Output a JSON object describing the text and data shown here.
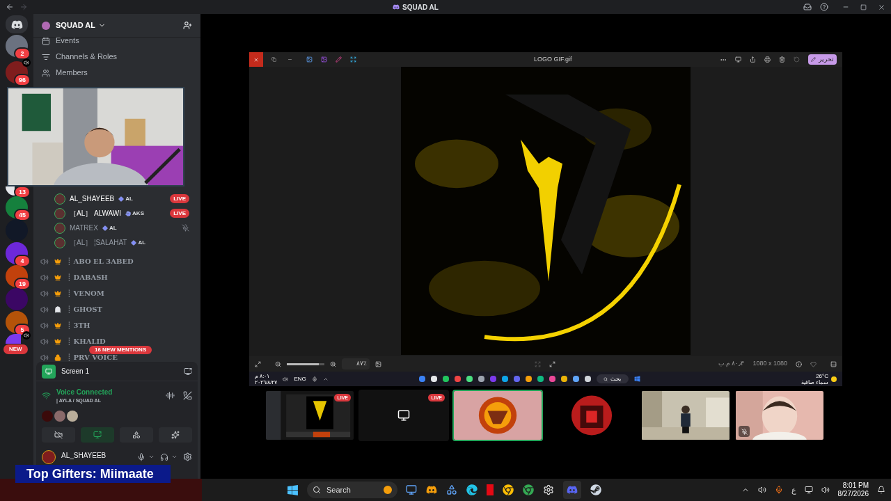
{
  "title_bar": {
    "title": "SQUAD AL"
  },
  "servers": [
    {
      "badge": "2",
      "voice": false,
      "color": "#6b7280"
    },
    {
      "badge": "96",
      "voice": true,
      "color": "#7f1d1d"
    },
    {
      "badge": "13",
      "voice": false,
      "color": "#e5e7eb"
    },
    {
      "badge": "45",
      "voice": false,
      "color": "#15803d"
    },
    {
      "voice": false,
      "color": "#111827"
    },
    {
      "badge": "4",
      "voice": false,
      "color": "#6d28d9"
    },
    {
      "badge": "19",
      "voice": false,
      "color": "#c2410c"
    },
    {
      "voice": false,
      "color": "#3b0764"
    },
    {
      "badge": "5",
      "voice": false,
      "color": "#b45309"
    },
    {
      "voice": true,
      "color": "#7c3aed"
    }
  ],
  "new_pill": "NEW",
  "server": {
    "name": "SQUAD AL",
    "menu": [
      {
        "label": "Events",
        "kind": "calendar"
      },
      {
        "label": "Channels & Roles",
        "kind": "list"
      },
      {
        "label": "Members",
        "kind": "users"
      }
    ]
  },
  "voice_users": [
    {
      "name": "AL_SHAYEEB",
      "tag": "AL",
      "kind": "diamond",
      "badge": "LIVE",
      "muted": false
    },
    {
      "name": "［AL］ ALWAWI",
      "tag": "AKS",
      "kind": "hand",
      "badge": "LIVE",
      "muted": false
    },
    {
      "name": "MATREX",
      "tag": "AL",
      "kind": "diamond",
      "muted": true
    },
    {
      "name": "［AL］ ¦SALAHAT",
      "tag": "AL",
      "kind": "diamond",
      "muted": false
    }
  ],
  "voice_channels": [
    {
      "name": "┊ ABO EL 3ABED",
      "kind": "crown"
    },
    {
      "name": "┊ DABASH",
      "kind": "crown"
    },
    {
      "name": "┊ VENOM",
      "kind": "crown"
    },
    {
      "name": "┊ GHOST",
      "kind": "ghost"
    },
    {
      "name": "┊ 3TH",
      "kind": "crown"
    },
    {
      "name": "┊  KHALID",
      "kind": "crown"
    },
    {
      "name": "┊ PRV VOICE",
      "kind": "lock"
    }
  ],
  "mentions": "16 NEW MENTIONS",
  "screen_panel": {
    "title": "Screen 1"
  },
  "voice_status": {
    "status": "Voice Connected",
    "channel": "| AYLA / SQUAD AL"
  },
  "user": {
    "name": "AL_SHAYEEB"
  },
  "viewer": {
    "file": "LOGO GIF.gif",
    "edit": "تحرير",
    "zoom": {
      "level": 0.85
    },
    "zoom_reading": "٨٧٪",
    "size": "٨٠٫٣ م.ب",
    "dimensions": "1080 x 1080"
  },
  "inner_taskbar": {
    "time": "٨:٠١ م",
    "date": "٢٠٢٦/٨/٢٧",
    "lang": "ENG",
    "search": "بحث",
    "temp": "26°C",
    "weather": "سماء صافية"
  },
  "tiles": [
    {
      "kind": "screen",
      "badge": "LIVE",
      "selected": false,
      "muted": false
    },
    {
      "kind": "monitor",
      "badge": "LIVE",
      "selected": false,
      "muted": false
    },
    {
      "kind": "logo",
      "selected": true,
      "muted": false
    },
    {
      "kind": "avatar",
      "selected": false,
      "muted": false
    },
    {
      "kind": "picture",
      "selected": false,
      "muted": false
    },
    {
      "kind": "webcam",
      "selected": false,
      "muted": true
    }
  ],
  "overlay": "Top Gifters: Miimaate",
  "taskbar": {
    "search": "Search",
    "lang": "ع",
    "time": "8:01 PM",
    "date": "8/27/2026"
  }
}
